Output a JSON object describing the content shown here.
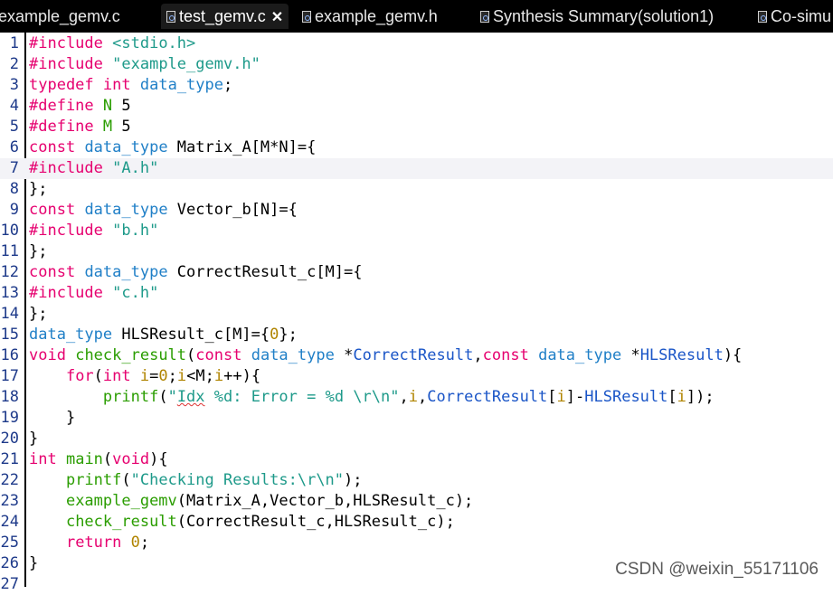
{
  "tabs": [
    {
      "label": "example_gemv.c",
      "active": false,
      "icon": "c-file-icon"
    },
    {
      "label": "test_gemv.c",
      "active": true,
      "icon": "c-file-icon",
      "close": "✕"
    },
    {
      "label": "example_gemv.h",
      "active": false,
      "icon": "h-file-icon"
    },
    {
      "label": "Synthesis Summary(solution1)",
      "active": false,
      "icon": "report-icon"
    },
    {
      "label": "Co-simu",
      "active": false,
      "icon": "report-icon"
    }
  ],
  "colors": {
    "keyword": "#e6006f",
    "type": "#1f7fc7",
    "string": "#1e9a8a",
    "function": "#2a9d00",
    "number": "#b08400",
    "param": "#1a55c7",
    "plain": "#000000",
    "lineno": "#1e3a8a"
  },
  "lines": [
    [
      {
        "t": "#include",
        "c": "keyword"
      },
      {
        "t": " "
      },
      {
        "t": "<stdio.h>",
        "c": "string"
      }
    ],
    [
      {
        "t": "#include",
        "c": "keyword"
      },
      {
        "t": " "
      },
      {
        "t": "\"example_gemv.h\"",
        "c": "string"
      }
    ],
    [
      {
        "t": "typedef",
        "c": "keyword"
      },
      {
        "t": " "
      },
      {
        "t": "int",
        "c": "keyword"
      },
      {
        "t": " "
      },
      {
        "t": "data_type",
        "c": "type"
      },
      {
        "t": ";"
      }
    ],
    [
      {
        "t": "#define",
        "c": "keyword"
      },
      {
        "t": " "
      },
      {
        "t": "N",
        "c": "function"
      },
      {
        "t": " 5"
      }
    ],
    [
      {
        "t": "#define",
        "c": "keyword"
      },
      {
        "t": " "
      },
      {
        "t": "M",
        "c": "function"
      },
      {
        "t": " 5"
      }
    ],
    [
      {
        "t": "const",
        "c": "keyword"
      },
      {
        "t": " "
      },
      {
        "t": "data_type",
        "c": "type"
      },
      {
        "t": " Matrix_A[M*N]={"
      }
    ],
    [
      {
        "t": "#include",
        "c": "keyword"
      },
      {
        "t": " "
      },
      {
        "t": "\"A.h\"",
        "c": "string"
      }
    ],
    [
      {
        "t": "};"
      }
    ],
    [
      {
        "t": "const",
        "c": "keyword"
      },
      {
        "t": " "
      },
      {
        "t": "data_type",
        "c": "type"
      },
      {
        "t": " Vector_b[N]={"
      }
    ],
    [
      {
        "t": "#include",
        "c": "keyword"
      },
      {
        "t": " "
      },
      {
        "t": "\"b.h\"",
        "c": "string"
      }
    ],
    [
      {
        "t": "};"
      }
    ],
    [
      {
        "t": "const",
        "c": "keyword"
      },
      {
        "t": " "
      },
      {
        "t": "data_type",
        "c": "type"
      },
      {
        "t": " CorrectResult_c[M]={"
      }
    ],
    [
      {
        "t": "#include",
        "c": "keyword"
      },
      {
        "t": " "
      },
      {
        "t": "\"c.h\"",
        "c": "string"
      }
    ],
    [
      {
        "t": "};"
      }
    ],
    [
      {
        "t": "data_type",
        "c": "type"
      },
      {
        "t": " HLSResult_c[M]={"
      },
      {
        "t": "0",
        "c": "number"
      },
      {
        "t": "};"
      }
    ],
    [
      {
        "t": "void",
        "c": "keyword"
      },
      {
        "t": " "
      },
      {
        "t": "check_result",
        "c": "function"
      },
      {
        "t": "("
      },
      {
        "t": "const",
        "c": "keyword"
      },
      {
        "t": " "
      },
      {
        "t": "data_type",
        "c": "type"
      },
      {
        "t": " *"
      },
      {
        "t": "CorrectResult",
        "c": "param"
      },
      {
        "t": ","
      },
      {
        "t": "const",
        "c": "keyword"
      },
      {
        "t": " "
      },
      {
        "t": "data_type",
        "c": "type"
      },
      {
        "t": " *"
      },
      {
        "t": "HLSResult",
        "c": "param"
      },
      {
        "t": "){"
      }
    ],
    [
      {
        "t": "    "
      },
      {
        "t": "for",
        "c": "keyword"
      },
      {
        "t": "("
      },
      {
        "t": "int",
        "c": "keyword"
      },
      {
        "t": " "
      },
      {
        "t": "i",
        "c": "number"
      },
      {
        "t": "="
      },
      {
        "t": "0",
        "c": "number"
      },
      {
        "t": ";"
      },
      {
        "t": "i",
        "c": "number"
      },
      {
        "t": "<M;"
      },
      {
        "t": "i",
        "c": "number"
      },
      {
        "t": "++){"
      }
    ],
    [
      {
        "t": "        "
      },
      {
        "t": "printf",
        "c": "function"
      },
      {
        "t": "("
      },
      {
        "t": "\"",
        "c": "string"
      },
      {
        "t": "Idx",
        "c": "string",
        "sq": true
      },
      {
        "t": " %d: Error = %d \\r\\n\"",
        "c": "string"
      },
      {
        "t": ","
      },
      {
        "t": "i",
        "c": "number"
      },
      {
        "t": ","
      },
      {
        "t": "CorrectResult",
        "c": "param"
      },
      {
        "t": "["
      },
      {
        "t": "i",
        "c": "number"
      },
      {
        "t": "]-"
      },
      {
        "t": "HLSResult",
        "c": "param"
      },
      {
        "t": "["
      },
      {
        "t": "i",
        "c": "number"
      },
      {
        "t": "]);"
      }
    ],
    [
      {
        "t": "    }"
      }
    ],
    [
      {
        "t": "}"
      }
    ],
    [
      {
        "t": "int",
        "c": "keyword"
      },
      {
        "t": " "
      },
      {
        "t": "main",
        "c": "function"
      },
      {
        "t": "("
      },
      {
        "t": "void",
        "c": "keyword"
      },
      {
        "t": "){"
      }
    ],
    [
      {
        "t": "    "
      },
      {
        "t": "printf",
        "c": "function"
      },
      {
        "t": "("
      },
      {
        "t": "\"Checking Results:\\r\\n\"",
        "c": "string"
      },
      {
        "t": ");"
      }
    ],
    [
      {
        "t": "    "
      },
      {
        "t": "example_gemv",
        "c": "function"
      },
      {
        "t": "(Matrix_A,Vector_b,HLSResult_c);"
      }
    ],
    [
      {
        "t": "    "
      },
      {
        "t": "check_result",
        "c": "function"
      },
      {
        "t": "(CorrectResult_c,HLSResult_c);"
      }
    ],
    [
      {
        "t": "    "
      },
      {
        "t": "return",
        "c": "keyword"
      },
      {
        "t": " "
      },
      {
        "t": "0",
        "c": "number"
      },
      {
        "t": ";"
      }
    ],
    [
      {
        "t": "}"
      }
    ],
    [
      {
        "t": ""
      }
    ]
  ],
  "highlighted_line": 7,
  "watermark": "CSDN @weixin_55171106"
}
